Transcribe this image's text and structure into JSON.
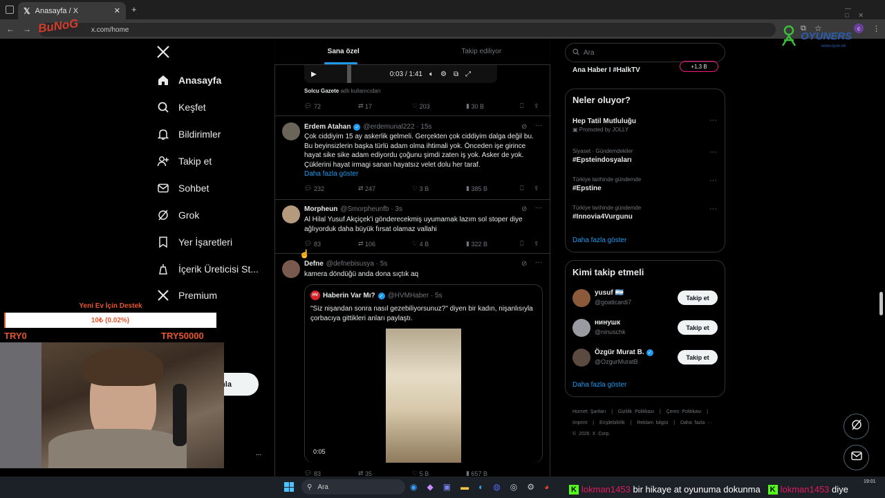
{
  "browser": {
    "tab_title": "Anasayfa / X",
    "url": "x.com/home",
    "close": "✕",
    "new_tab": "+"
  },
  "nav": {
    "items": [
      {
        "label": "Anasayfa",
        "icon": "home-icon"
      },
      {
        "label": "Keşfet",
        "icon": "search-icon"
      },
      {
        "label": "Bildirimler",
        "icon": "bell-icon"
      },
      {
        "label": "Takip et",
        "icon": "follow-icon"
      },
      {
        "label": "Sohbet",
        "icon": "mail-icon"
      },
      {
        "label": "Grok",
        "icon": "grok-icon"
      },
      {
        "label": "Yer İşaretleri",
        "icon": "bookmark-icon"
      },
      {
        "label": "İçerik Üreticisi St...",
        "icon": "creator-icon"
      },
      {
        "label": "Premium",
        "icon": "x-icon"
      }
    ],
    "post_button_partial": "nla",
    "more": "..."
  },
  "overlay": {
    "donation_title": "Yeni Ev İçin Destek",
    "donation_value": "10₺ (0.02%)",
    "donation_progress_pct": 0.02,
    "min": "TRY0",
    "max": "TRY50000",
    "logo_left": "BuNoG",
    "logo_right": "OYUNERS",
    "logo_right_sub": "www.oyun.ek"
  },
  "tabs": {
    "for_you": "Sana özel",
    "following": "Takip ediliyor"
  },
  "video_top": {
    "time": "0:03 / 1:41",
    "source_name": "Solcu Gazete",
    "source_suffix": "adlı kullanıcıdan",
    "replies": "72",
    "reposts": "17",
    "likes": "203",
    "views": "30 B"
  },
  "tweets": [
    {
      "name": "Erdem Atahan",
      "handle": "@erdemunal222 · 15s",
      "verified": true,
      "text": [
        "Çok ciddiyim 15 ay askerlik gelmeli. Gerçekten çok ciddiyim dalga değil bu.",
        "Bu beyinsizlerin başka türlü adam olma ihtimali yok. Önceden işe girince",
        "hayat sike sike adam ediyordu çoğunu şimdi zaten iş yok. Asker de yok.",
        "Çüklerini hayat irmagi sanan hayatsız velet dolu her taraf."
      ],
      "more": "Daha fazla göster",
      "replies": "232",
      "reposts": "247",
      "likes": "3 B",
      "views": "385 B"
    },
    {
      "name": "Morpheun",
      "handle": "@Smorpheunfb · 3s",
      "verified": false,
      "text": [
        "Al Hilal Yusuf Akçiçek'i gönderecekmiş uyumamak lazım sol stoper diye",
        "ağlıyorduk daha büyük fırsat olamaz vallahi"
      ],
      "replies": "83",
      "reposts": "106",
      "likes": "4 B",
      "views": "322 B"
    },
    {
      "name": "Defne",
      "handle": "@defnebisusya · 5s",
      "verified": false,
      "text": [
        "kamera döndüğü anda dona sıçtık aq"
      ],
      "quote": {
        "name": "Haberin Var Mı?",
        "handle": "@HVMHaber · 5s",
        "text": [
          "\"Siz nişandan sonra nasıl gezebiliyorsunuz?\" diyen bir kadın, nişanlısıyla",
          "çorbacıya gittikleri anları paylaştı."
        ],
        "video_time": "0:05"
      },
      "replies": "83",
      "reposts": "35",
      "likes": "5 B",
      "views": "657 B"
    }
  ],
  "right": {
    "search_placeholder": "Ara",
    "top_trend": "Ana Haber I #HalkTV",
    "top_count": "+1,3 B",
    "whats_happening": "Neler oluyor?",
    "trends": [
      {
        "cat": "",
        "name": "Hep Tatil Mutluluğu",
        "sub": "Promoted by JOLLY"
      },
      {
        "cat": "Siyaset · Gündemdekiler",
        "name": "#Epsteindosyaları",
        "sub": ""
      },
      {
        "cat": "Türkiye tarihinde gündemde",
        "name": "#Epstine",
        "sub": ""
      },
      {
        "cat": "Türkiye tarihinde gündemde",
        "name": "#Innovia4Vurgunu",
        "sub": ""
      }
    ],
    "show_more": "Daha fazla göster",
    "who_to_follow": "Kimi takip etmeli",
    "suggestions": [
      {
        "name": "yusuf 🇦🇷",
        "handle": "@goaticardi7",
        "verified": false
      },
      {
        "name": "нинушк",
        "handle": "@ninuschk",
        "verified": false
      },
      {
        "name": "Özgür Murat B.",
        "handle": "@OzgurMuratB",
        "verified": true
      }
    ],
    "follow_label": "Takip et",
    "footer": [
      "Hizmet Şartları",
      "|",
      "Gizlilik Politikası",
      "|",
      "Çerez Politikası",
      "|",
      "Imprint",
      "|",
      "Erişilebilirlik",
      "|",
      "Reklam bilgisi",
      "|",
      "Daha fazla ···"
    ],
    "copyright": "© 2026 X Corp."
  },
  "taskbar": {
    "search": "Ara",
    "time": "19:01",
    "chat1_user": "lokman1453",
    "chat1_msg": "bir hikaye at oyunuma dokunma",
    "chat2_user": "lokman1453",
    "chat2_msg": "diye"
  }
}
